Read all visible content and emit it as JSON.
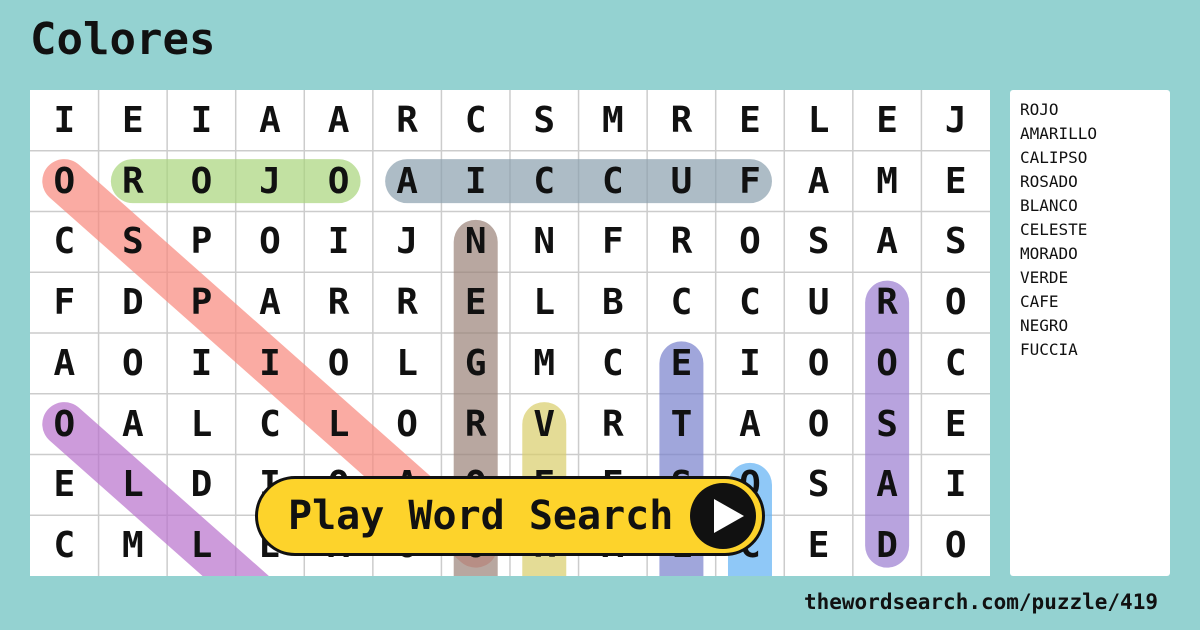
{
  "title": "Colores",
  "grid": [
    [
      "I",
      "E",
      "I",
      "A",
      "A",
      "R",
      "C",
      "S",
      "M",
      "R",
      "E",
      "L",
      "E",
      "J"
    ],
    [
      "O",
      "R",
      "O",
      "J",
      "O",
      "A",
      "I",
      "C",
      "C",
      "U",
      "F",
      "A",
      "M",
      "E"
    ],
    [
      "C",
      "S",
      "P",
      "O",
      "I",
      "J",
      "N",
      "N",
      "F",
      "R",
      "O",
      "S",
      "A",
      "S"
    ],
    [
      "F",
      "D",
      "P",
      "A",
      "R",
      "R",
      "E",
      "L",
      "B",
      "C",
      "C",
      "U",
      "R",
      "O"
    ],
    [
      "A",
      "O",
      "I",
      "I",
      "O",
      "L",
      "G",
      "M",
      "C",
      "E",
      "I",
      "O",
      "O",
      "C"
    ],
    [
      "O",
      "A",
      "L",
      "C",
      "L",
      "O",
      "R",
      "V",
      "R",
      "T",
      "A",
      "O",
      "S",
      "E"
    ],
    [
      "E",
      "L",
      "D",
      "I",
      "O",
      "A",
      "O",
      "E",
      "E",
      "S",
      "O",
      "S",
      "A",
      "I"
    ],
    [
      "C",
      "M",
      "L",
      "E",
      "A",
      "O",
      "O",
      "R",
      "A",
      "L",
      "C",
      "E",
      "D",
      "O"
    ]
  ],
  "words": [
    "ROJO",
    "AMARILLO",
    "CALIPSO",
    "ROSADO",
    "BLANCO",
    "CELESTE",
    "MORADO",
    "VERDE",
    "CAFE",
    "NEGRO",
    "FUCCIA"
  ],
  "play_button": {
    "label": "Play Word Search",
    "icon": "play-icon"
  },
  "footer": "thewordsearch.com/puzzle/419",
  "colors": {
    "background": "#94d2d1",
    "button": "#fdd32b"
  }
}
